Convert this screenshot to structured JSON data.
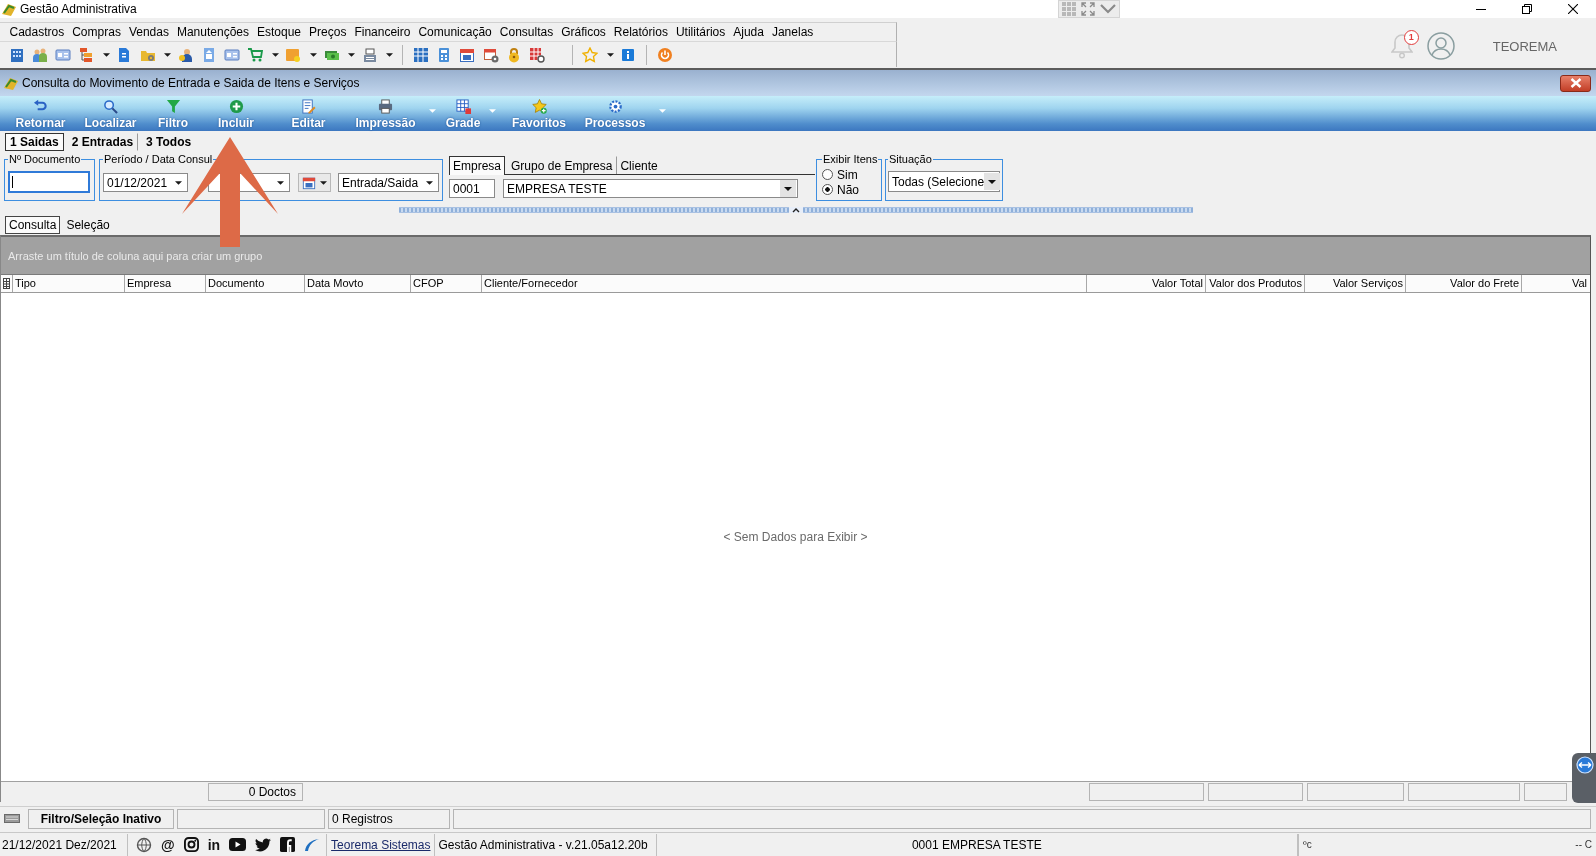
{
  "window": {
    "title": "Gestão Administrativa"
  },
  "menu": [
    "Cadastros",
    "Compras",
    "Vendas",
    "Manutenções",
    "Estoque",
    "Preços",
    "Financeiro",
    "Comunicação",
    "Consultas",
    "Gráficos",
    "Relatórios",
    "Utilitários",
    "Ajuda",
    "Janelas"
  ],
  "account": {
    "notifications": "1",
    "user": "TEOREMA"
  },
  "child_window": {
    "title": "Consulta do Movimento de Entrada e Saida de Itens e Serviços"
  },
  "ribbon": [
    {
      "label": "Retornar",
      "menu": false
    },
    {
      "label": "Localizar",
      "menu": false
    },
    {
      "label": "Filtro",
      "menu": false
    },
    {
      "label": "Incluir",
      "menu": false
    },
    {
      "label": "Editar",
      "menu": false
    },
    {
      "label": "Impressão",
      "menu": true
    },
    {
      "label": "Grade",
      "menu": true
    },
    {
      "label": "Favoritos",
      "menu": false
    },
    {
      "label": "Processos",
      "menu": true
    }
  ],
  "direction_tabs": [
    {
      "label": "1 Saidas",
      "selected": true
    },
    {
      "label": "2 Entradas",
      "selected": false
    },
    {
      "label": "3 Todos",
      "selected": false
    }
  ],
  "filters": {
    "document": {
      "label": "Nº Documento",
      "focused": true
    },
    "period": {
      "label": "Período / Data Consul",
      "start": "01/12/2021",
      "movement": "Entrada/Saida"
    },
    "company_tabs": [
      {
        "label": "Empresa",
        "selected": true
      },
      {
        "label": "Grupo de Empresa",
        "selected": false
      },
      {
        "label": "Cliente",
        "selected": false
      }
    ],
    "company_code": "0001",
    "company_name": "EMPRESA TESTE",
    "show_items": {
      "label": "Exibir Itens",
      "options": [
        {
          "label": "Sim",
          "selected": false
        },
        {
          "label": "Não",
          "selected": true
        }
      ]
    },
    "situation": {
      "label": "Situação",
      "value": "Todas (Selecione"
    }
  },
  "view_tabs": [
    {
      "label": "Consulta",
      "selected": true
    },
    {
      "label": "Seleção",
      "selected": false
    }
  ],
  "grid": {
    "group_hint": "Arraste um título de coluna aqui para criar um grupo",
    "columns": [
      {
        "label": "Tipo",
        "kind": "text"
      },
      {
        "label": "Empresa",
        "kind": "text"
      },
      {
        "label": "Documento",
        "kind": "text"
      },
      {
        "label": "Data Movto",
        "kind": "text"
      },
      {
        "label": "CFOP",
        "kind": "text"
      },
      {
        "label": "Cliente/Fornecedor",
        "kind": "text"
      },
      {
        "label": "Valor Total",
        "kind": "value"
      },
      {
        "label": "Valor dos Produtos",
        "kind": "value"
      },
      {
        "label": "Valor Serviços",
        "kind": "value"
      },
      {
        "label": "Valor do Frete",
        "kind": "value"
      },
      {
        "label": "Val",
        "kind": "value"
      }
    ],
    "empty_message": "< Sem Dados para Exibir >",
    "footer_count": "0 Doctos"
  },
  "status_bar": {
    "filter_state": "Filtro/Seleção Inativo",
    "records": "0 Registros"
  },
  "info_bar": {
    "date": "21/12/2021 Dez/2021",
    "glyphs": [
      "@",
      "in"
    ],
    "link": "Teorema Sistemas",
    "version": "Gestão Administrativa - v.21.05a12.20b",
    "company": "0001 EMPRESA TESTE",
    "tray_texts": [
      "ºc",
      "-- C"
    ]
  }
}
